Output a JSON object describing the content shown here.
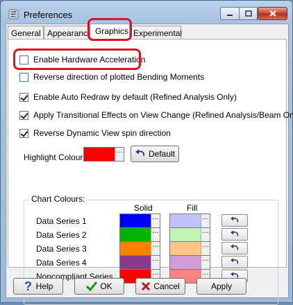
{
  "window": {
    "title": "Preferences"
  },
  "tabs": [
    {
      "label": "General"
    },
    {
      "label": "Appearance"
    },
    {
      "label": "Graphics"
    },
    {
      "label": "Experimental"
    }
  ],
  "graphics": {
    "options": [
      {
        "label": "Enable Hardware Acceleration",
        "checked": false
      },
      {
        "label": "Reverse direction of plotted Bending Moments",
        "checked": false
      },
      {
        "label": "Enable Auto Redraw by default  (Refined Analysis Only)",
        "checked": true
      },
      {
        "label": "Apply Transitional Effects on View Change (Refined Analysis/Beam Only)",
        "checked": true
      },
      {
        "label": "Reverse Dynamic View spin direction",
        "checked": true
      }
    ],
    "highlight": {
      "label": "Highlight Colour:",
      "color": "#ff0000",
      "default_label": "Default"
    },
    "chart_colours": {
      "title": "Chart Colours:",
      "solid_header": "Solid",
      "fill_header": "Fill",
      "rows": [
        {
          "label": "Data Series 1",
          "solid": "#0000ff",
          "fill": "#c2c2fa"
        },
        {
          "label": "Data Series 2",
          "solid": "#00b400",
          "fill": "#c2f5b5"
        },
        {
          "label": "Data Series 3",
          "solid": "#ff7f00",
          "fill": "#ffc585"
        },
        {
          "label": "Data Series 4",
          "solid": "#8b3a8e",
          "fill": "#d49ad6"
        },
        {
          "label": "Noncompliant Series",
          "solid": "#ff0000",
          "fill": "#ff8080"
        }
      ]
    }
  },
  "buttons": {
    "help": "Help",
    "ok": "OK",
    "cancel": "Cancel",
    "apply": "Apply"
  },
  "colors": {
    "annotation_red": "#e01020",
    "titlebar": "#b9d1ea"
  },
  "icons": [
    "preferences-app-icon",
    "minimize-icon",
    "maximize-icon",
    "close-icon",
    "undo-arrow-icon",
    "help-question-icon",
    "ok-checkmark-icon",
    "cancel-x-icon",
    "ellipsis-icon"
  ]
}
